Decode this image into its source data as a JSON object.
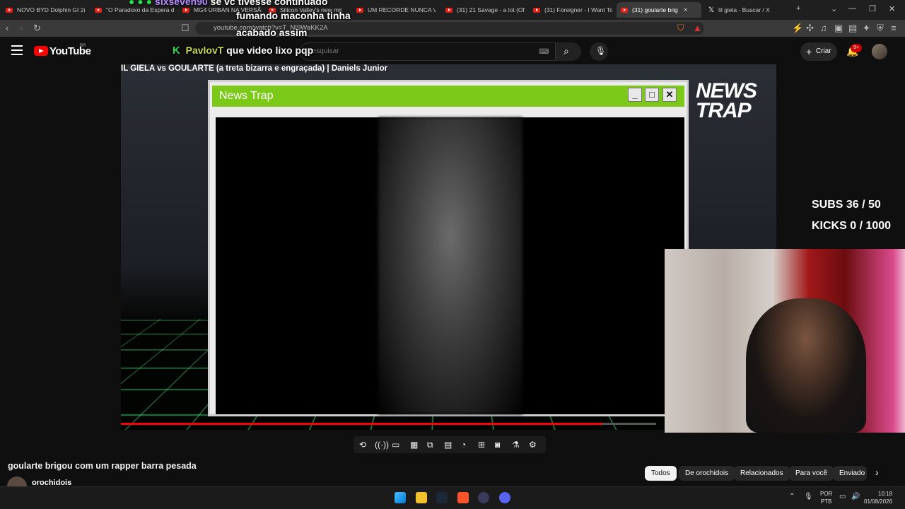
{
  "tabs": [
    {
      "label": "NOVO BYD Dolphin GI 2("
    },
    {
      "label": "\"O Paradoxo da Espera d"
    },
    {
      "label": "MG4 URBAN NA VERSÃC"
    },
    {
      "label": "Silicon Valley's new mir"
    },
    {
      "label": "UM RECORDE NUNCA VI"
    },
    {
      "label": "(31) 21 Savage - a lot (Of"
    },
    {
      "label": "(31) Foreigner - I Want To"
    },
    {
      "label": "(31) goularte brig"
    },
    {
      "label": "lil giela - Buscar / X"
    }
  ],
  "tab_close": "×",
  "new_tab": "+",
  "address": "youtube.com/watch?v=T_NI9WaKK2A",
  "yt": {
    "logo": "YouTube",
    "region": "BR",
    "search_placeholder": "Pesquisar",
    "create": "Criar",
    "notif_count": "9+"
  },
  "chat": {
    "line1_user": "sixseven90",
    "line1_msg": "se vc tivesse continuado",
    "line2": "fumando maconha tinha",
    "line3": "acabado assim",
    "line4_user": "PavlovT",
    "line4_msg": "que video lixo pqp"
  },
  "video": {
    "header_title": "IL GIELA vs GOULARTE (a treta bizarra e engraçada) | Daniels Junior",
    "window_title": "News Trap",
    "brand_line1": "NEWS",
    "brand_line2": "TRAP",
    "subs": "SUBS 36 / 50",
    "kicks": "KICKS 0 / 1000",
    "progress_fraction": 0.9
  },
  "player_title": "goularte brigou com um rapper barra pesada",
  "channel": "orochidois",
  "chips": [
    "Todos",
    "De orochidois",
    "Relacionados",
    "Para você",
    "Enviado"
  ],
  "taskbar": {
    "lang1": "POR",
    "lang2": "PTB",
    "time": "10:18",
    "date": "01/08/2026"
  },
  "colors": {
    "youtube_red": "#ff0000",
    "window_green": "#7cc91a",
    "grid_green": "#58ff8c"
  }
}
